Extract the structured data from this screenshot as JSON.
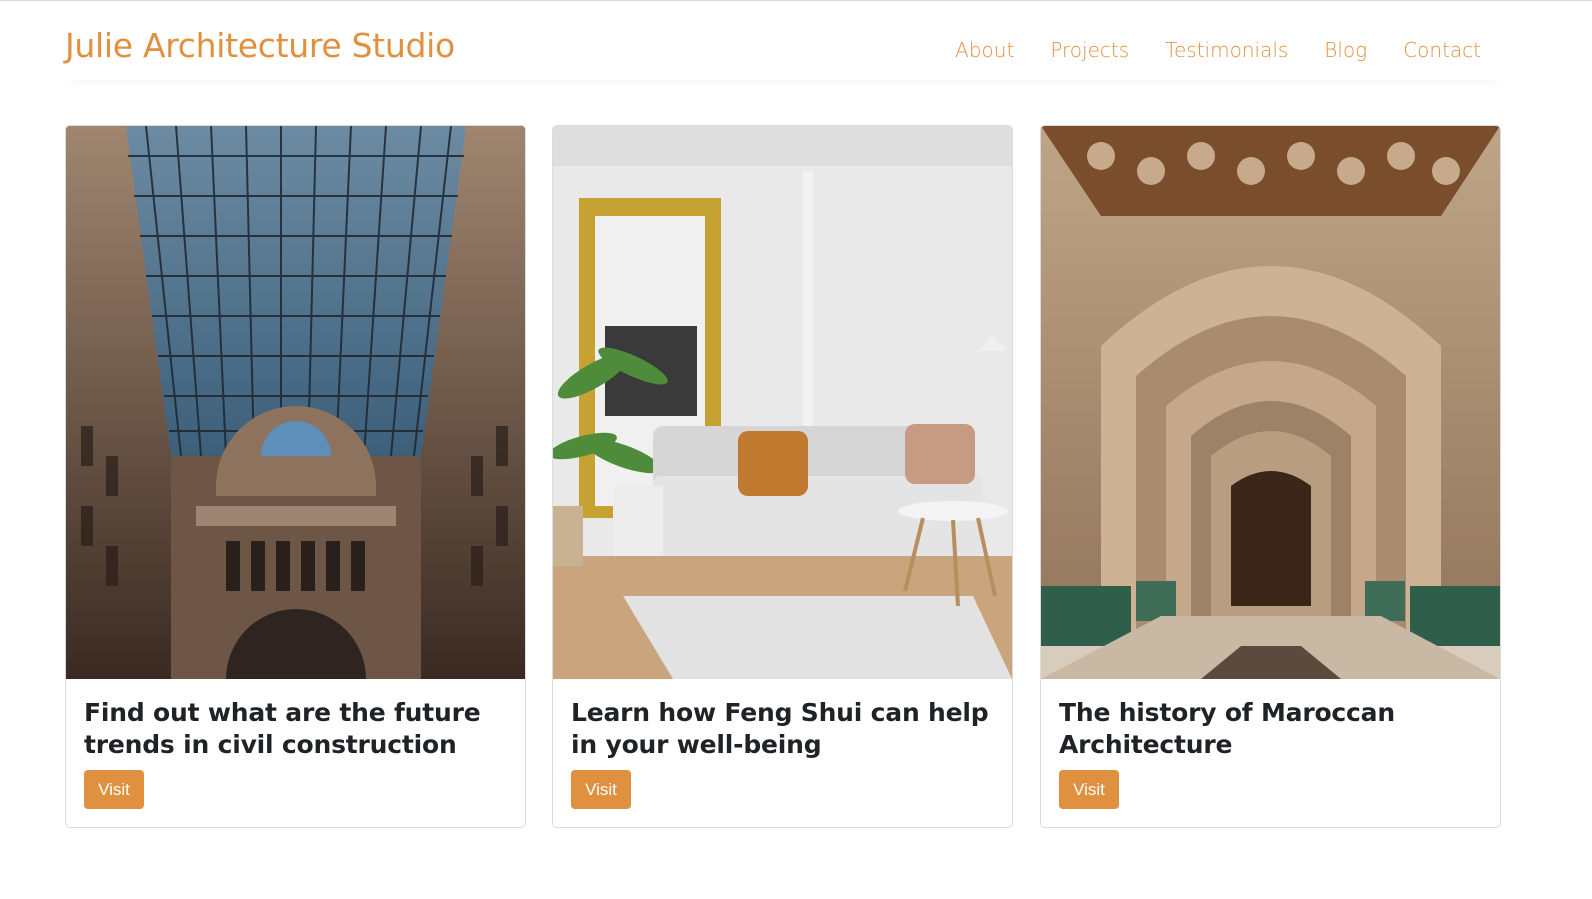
{
  "header": {
    "brand": "Julie Architecture Studio",
    "nav": [
      "About",
      "Projects",
      "Testimonials",
      "Blog",
      "Contact"
    ]
  },
  "cards": [
    {
      "title": "Find out what are the future trends in civil construction",
      "button": "Visit",
      "image": "glass-dome-gallery-photo"
    },
    {
      "title": "Learn how Feng Shui can help in your well-being",
      "button": "Visit",
      "image": "living-room-sofa-photo"
    },
    {
      "title": "The history of Maroccan Architecture",
      "button": "Visit",
      "image": "moroccan-arches-photo"
    }
  ],
  "colors": {
    "accent": "#e0913f",
    "text": "#1f2326",
    "border": "#dcdcdc"
  }
}
